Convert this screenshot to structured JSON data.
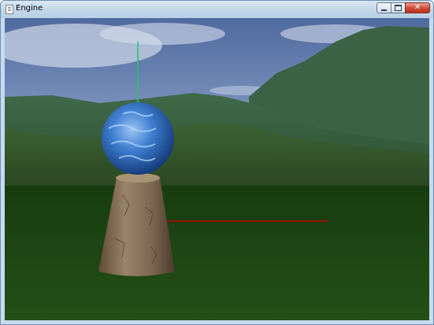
{
  "window": {
    "title": "Engine",
    "controls": [
      "minimize-icon",
      "maximize-icon",
      "close-icon"
    ],
    "close_glyph": "✕"
  },
  "colors": {
    "titlebar": "#c6dbee",
    "x_axis_line": "#c00000",
    "y_axis_line": "#22c860",
    "ground": "#1f4a13",
    "sky": "#5c75a6"
  }
}
